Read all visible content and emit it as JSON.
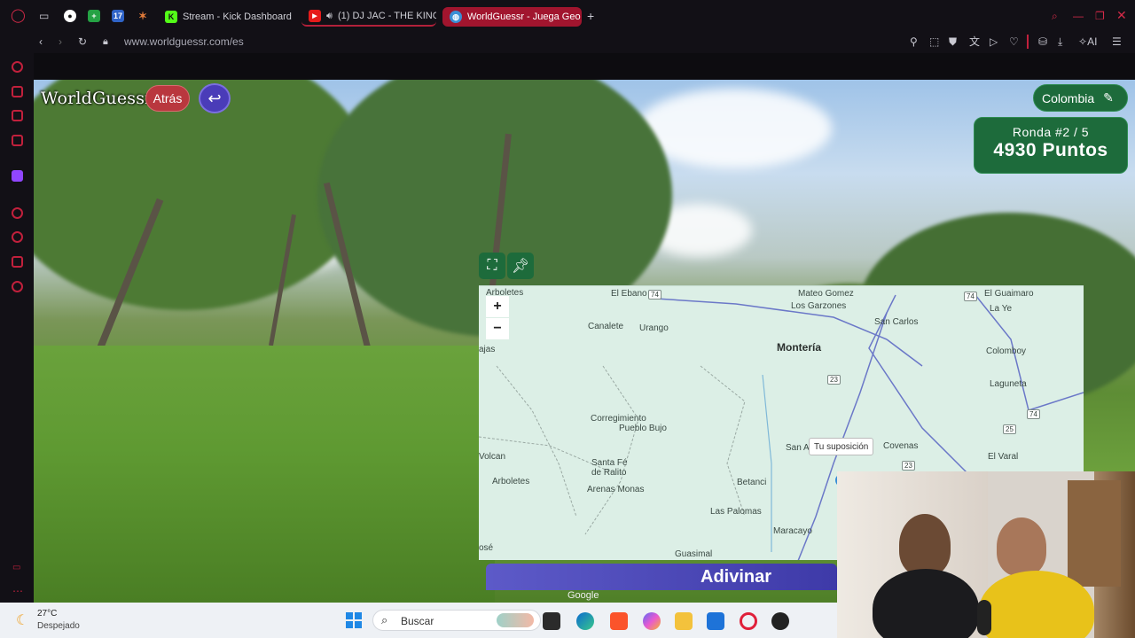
{
  "browser": {
    "tabs": [
      {
        "label": "Stream - Kick Dashboard",
        "icon": "kick-icon"
      },
      {
        "label": "(1) DJ JAC - THE KING",
        "icon": "youtube-icon"
      },
      {
        "label": "WorldGuessr - Juega Geo",
        "icon": "globe-icon"
      }
    ],
    "pinned_17": "17",
    "address": "www.worldguessr.com/es",
    "ai_label": "AI"
  },
  "game": {
    "logo": "WorldGuessr",
    "back_label": "Atrás",
    "country_label": "Colombia",
    "round_label": "Ronda #2 / 5",
    "points_label": "4930 Puntos",
    "guess_button": "Adivinar",
    "google_label": "Google"
  },
  "map": {
    "zoom_in": "+",
    "zoom_out": "−",
    "guess_tooltip": "Tu suposición",
    "places": [
      {
        "name": "Arboletes",
        "id": "arboletes-top"
      },
      {
        "name": "El Ebano",
        "id": "el-ebano"
      },
      {
        "name": "Mateo Gomez",
        "id": "mateo-gomez"
      },
      {
        "name": "Los Garzones",
        "id": "los-garzones"
      },
      {
        "name": "El Guaimaro",
        "id": "el-guaimaro"
      },
      {
        "name": "La Ye",
        "id": "la-ye"
      },
      {
        "name": "Canalete",
        "id": "canalete"
      },
      {
        "name": "Urango",
        "id": "urango"
      },
      {
        "name": "Montería",
        "id": "monteria"
      },
      {
        "name": "San Carlos",
        "id": "san-carlos"
      },
      {
        "name": "Colomboy",
        "id": "colomboy"
      },
      {
        "name": "ajas",
        "id": "ajas"
      },
      {
        "name": "Laguneta",
        "id": "laguneta"
      },
      {
        "name": "Corregimiento",
        "id": "corregimiento"
      },
      {
        "name": "Pueblo Bujo",
        "id": "pueblo-bujo"
      },
      {
        "name": "Covenas",
        "id": "covenas"
      },
      {
        "name": "San A",
        "id": "san-a"
      },
      {
        "name": "Volcan",
        "id": "volcan"
      },
      {
        "name": "El Varal",
        "id": "el-varal"
      },
      {
        "name": "Santa Fé",
        "id": "santa-fe"
      },
      {
        "name": "de Ralito",
        "id": "de-ralito"
      },
      {
        "name": "Arboletes",
        "id": "arboletes"
      },
      {
        "name": "Arenas Monas",
        "id": "arenas-monas"
      },
      {
        "name": "Betanci",
        "id": "betanci"
      },
      {
        "name": "Las Palomas",
        "id": "las-palomas"
      },
      {
        "name": "Maracayo",
        "id": "maracayo"
      },
      {
        "name": "Guasimal",
        "id": "guasimal"
      },
      {
        "name": "osé",
        "id": "ose"
      }
    ],
    "shields": [
      "74",
      "23",
      "74",
      "74",
      "25",
      "23"
    ]
  },
  "taskbar": {
    "temperature": "27°C",
    "weather": "Despejado",
    "search_placeholder": "Buscar"
  },
  "colors": {
    "accent_green": "#1d6b3b",
    "back_red": "#b9373e",
    "guess_purple": "#4a45b8",
    "browser_accent": "#c1203c"
  }
}
